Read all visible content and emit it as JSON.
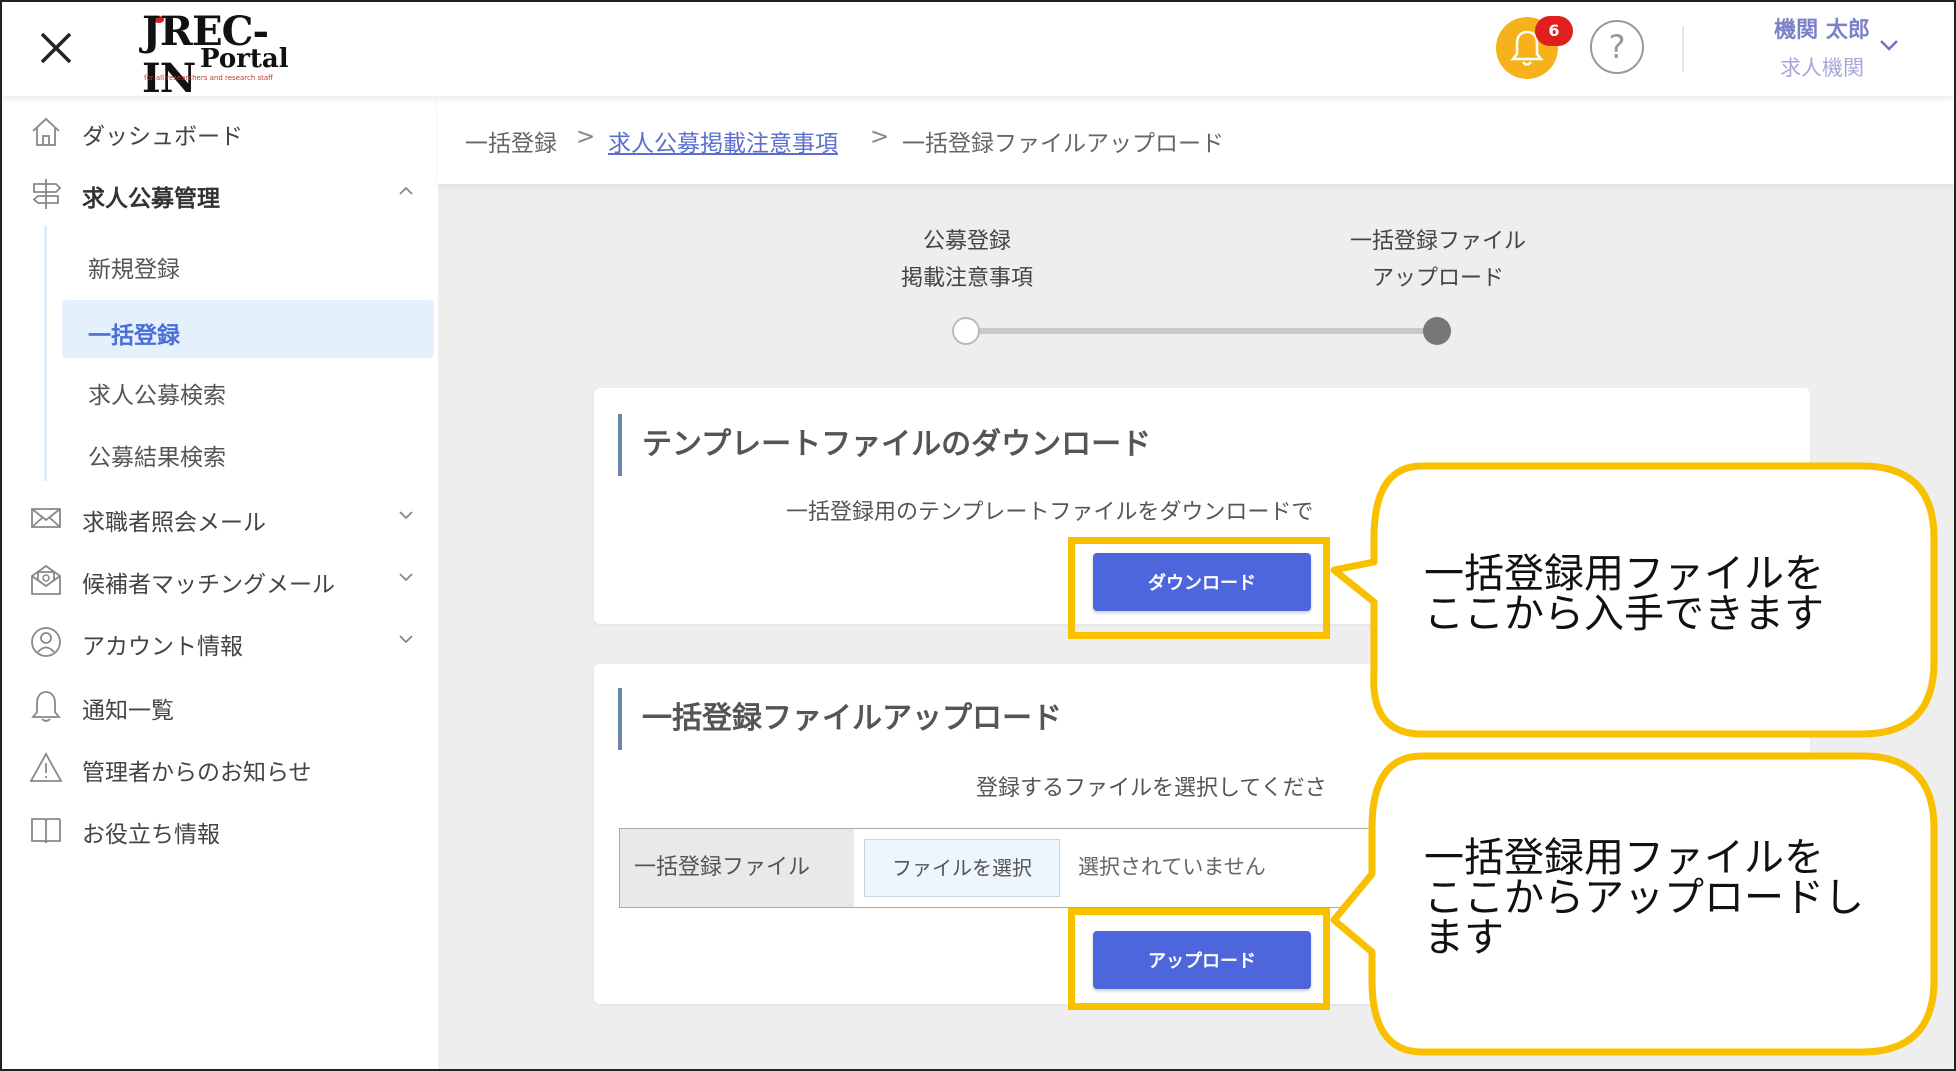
{
  "header": {
    "logo_text": "JREC-IN",
    "logo_sub": "Portal",
    "logo_tagline": "for all researchers and research staff",
    "notification_count": "6",
    "help_label": "?",
    "user_name": "機関 太郎",
    "user_org": "求人機関"
  },
  "sidebar": {
    "items": [
      {
        "label": "ダッシュボード"
      },
      {
        "label": "求人公募管理"
      },
      {
        "label": "求職者照会メール"
      },
      {
        "label": "候補者マッチングメール"
      },
      {
        "label": "アカウント情報"
      },
      {
        "label": "通知一覧"
      },
      {
        "label": "管理者からのお知らせ"
      },
      {
        "label": "お役立ち情報"
      }
    ],
    "sub_items": [
      {
        "label": "新規登録"
      },
      {
        "label": "一括登録"
      },
      {
        "label": "求人公募検索"
      },
      {
        "label": "公募結果検索"
      }
    ]
  },
  "breadcrumb": {
    "item1": "一括登録",
    "sep": ">",
    "item2": "求人公募掲載注意事項",
    "item3": "一括登録ファイルアップロード"
  },
  "steps": [
    {
      "line1": "公募登録",
      "line2": "掲載注意事項"
    },
    {
      "line1": "一括登録ファイル",
      "line2": "アップロード"
    }
  ],
  "download_card": {
    "title": "テンプレートファイルのダウンロード",
    "text": "一括登録用のテンプレートファイルをダウンロードで",
    "button": "ダウンロード"
  },
  "upload_card": {
    "title": "一括登録ファイルアップロード",
    "text": "登録するファイルを選択してくださ",
    "field_label": "一括登録ファイル",
    "choose_button": "ファイルを選択",
    "file_status": "選択されていません",
    "button": "アップロード"
  },
  "callouts": [
    {
      "line1": "一括登録用ファイルを",
      "line2": "ここから入手できます"
    },
    {
      "line1": "一括登録用ファイルを",
      "line2": "ここからアップロードし",
      "line3": "ます"
    }
  ],
  "colors": {
    "accent": "#4d66dc",
    "highlight": "#f9c000",
    "bell": "#f7b21b",
    "badge": "#e0201f"
  }
}
